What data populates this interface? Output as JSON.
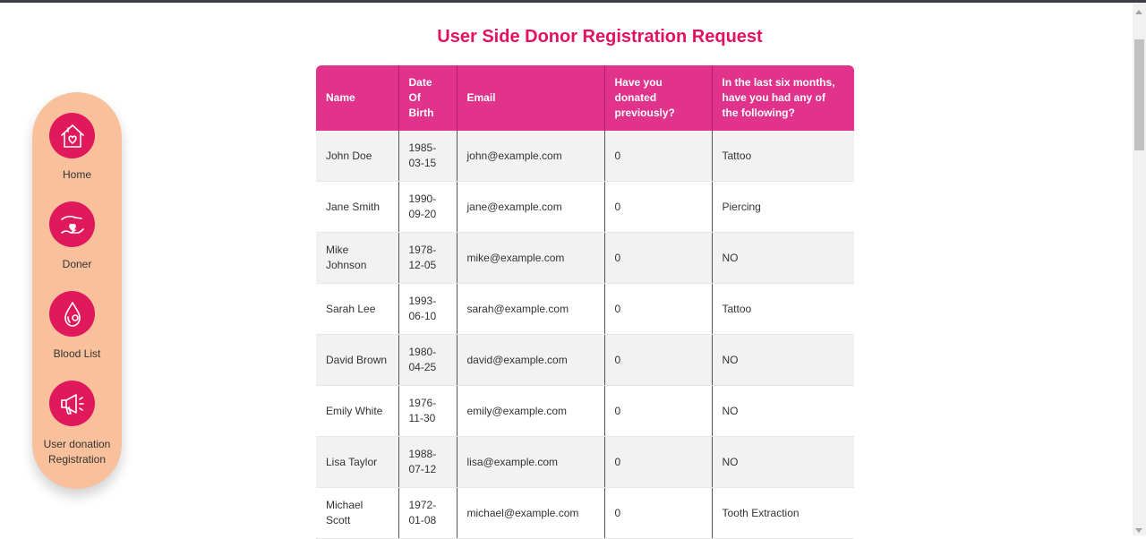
{
  "page": {
    "title": "User Side Donor Registration Request"
  },
  "sidebar": {
    "items": [
      {
        "label": "Home",
        "icon": "house-heart-icon"
      },
      {
        "label": "Doner",
        "icon": "hand-heart-icon"
      },
      {
        "label": "Blood List",
        "icon": "blood-drop-icon"
      },
      {
        "label": "User donation Registration",
        "icon": "megaphone-icon"
      }
    ]
  },
  "table": {
    "headers": [
      "Name",
      "Date Of Birth",
      "Email",
      "Have you donated previously?",
      "In the last six months, have you had any of the following?"
    ],
    "rows": [
      [
        "John Doe",
        "1985-03-15",
        "john@example.com",
        "0",
        "Tattoo"
      ],
      [
        "Jane Smith",
        "1990-09-20",
        "jane@example.com",
        "0",
        "Piercing"
      ],
      [
        "Mike Johnson",
        "1978-12-05",
        "mike@example.com",
        "0",
        "NO"
      ],
      [
        "Sarah Lee",
        "1993-06-10",
        "sarah@example.com",
        "0",
        "Tattoo"
      ],
      [
        "David Brown",
        "1980-04-25",
        "david@example.com",
        "0",
        "NO"
      ],
      [
        "Emily White",
        "1976-11-30",
        "emily@example.com",
        "0",
        "NO"
      ],
      [
        "Lisa Taylor",
        "1988-07-12",
        "lisa@example.com",
        "0",
        "NO"
      ],
      [
        "Michael Scott",
        "1972-01-08",
        "michael@example.com",
        "0",
        "Tooth Extraction"
      ]
    ]
  },
  "colors": {
    "accent": "#e3115f",
    "header_bg": "#e1338b",
    "sidebar_bg": "#f9c09c",
    "icon_bg": "#e0195d"
  }
}
